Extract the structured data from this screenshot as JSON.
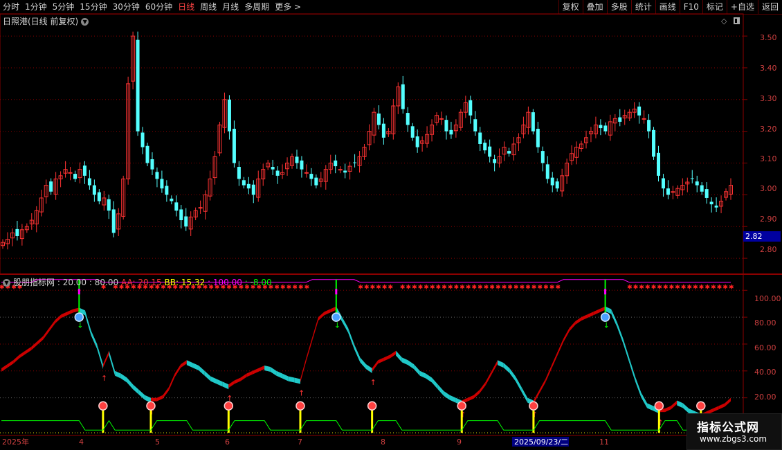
{
  "toolbar": {
    "timeframes": [
      "分时",
      "1分钟",
      "5分钟",
      "15分钟",
      "30分钟",
      "60分钟",
      "日线",
      "周线",
      "月线",
      "多周期",
      "更多 >"
    ],
    "active_index": 6,
    "right_buttons": [
      "复权",
      "叠加",
      "多股",
      "统计",
      "画线",
      "F10",
      "标记",
      "+自选",
      "返回"
    ]
  },
  "main_title": "日照港(日线 前复权)",
  "price_axis": {
    "ticks": [
      "3.50",
      "3.40",
      "3.30",
      "3.20",
      "3.10",
      "3.00",
      "2.90",
      "2.80"
    ],
    "current_price": "2.82"
  },
  "indicator": {
    "name": "股朋指标网",
    "p1": ": 20.00",
    "p2": ": 80.00",
    "aa": "AA: 20.15",
    "bb": "BB: 15.32",
    "c": ": 100.00",
    "d": ": -8.00",
    "axis_ticks": [
      "100.00",
      "80.00",
      "60.00",
      "40.00",
      "20.00"
    ]
  },
  "date_axis": {
    "labels": [
      "2025年",
      "4",
      "5",
      "6",
      "7",
      "8",
      "9",
      "2025/09/23/二",
      "11"
    ]
  },
  "watermark": {
    "line1": "指标公式网",
    "line2": "www.zbgs3.com"
  },
  "colors": {
    "up": "#ff3333",
    "down": "#54ffff",
    "grid": "#8b0000",
    "magenta": "#ff00ff",
    "yellow": "#ffff00",
    "green": "#00ff00"
  },
  "chart_data": {
    "type": "candlestick",
    "price_ylim": [
      2.75,
      3.57
    ],
    "closes": [
      2.85,
      2.86,
      2.88,
      2.87,
      2.89,
      2.9,
      2.92,
      2.95,
      2.99,
      3.03,
      3.01,
      3.05,
      3.06,
      3.08,
      3.07,
      3.05,
      3.08,
      3.06,
      3.03,
      3.0,
      2.98,
      2.99,
      2.95,
      2.88,
      2.94,
      3.05,
      3.35,
      3.5,
      3.2,
      3.15,
      3.1,
      3.08,
      3.05,
      3.02,
      3.0,
      2.98,
      2.95,
      2.92,
      2.9,
      2.93,
      2.95,
      2.96,
      3.0,
      3.05,
      3.12,
      3.22,
      3.3,
      3.2,
      3.1,
      3.05,
      3.03,
      3.02,
      3.0,
      3.05,
      3.08,
      3.1,
      3.08,
      3.06,
      3.07,
      3.1,
      3.12,
      3.1,
      3.08,
      3.07,
      3.05,
      3.03,
      3.05,
      3.08,
      3.1,
      3.09,
      3.08,
      3.07,
      3.09,
      3.1,
      3.12,
      3.15,
      3.2,
      3.26,
      3.22,
      3.18,
      3.2,
      3.28,
      3.34,
      3.27,
      3.22,
      3.18,
      3.15,
      3.17,
      3.19,
      3.22,
      3.25,
      3.24,
      3.2,
      3.19,
      3.22,
      3.26,
      3.29,
      3.25,
      3.2,
      3.16,
      3.14,
      3.12,
      3.1,
      3.12,
      3.15,
      3.13,
      3.16,
      3.18,
      3.22,
      3.26,
      3.2,
      3.15,
      3.1,
      3.05,
      3.03,
      3.02,
      3.06,
      3.1,
      3.13,
      3.15,
      3.16,
      3.18,
      3.2,
      3.22,
      3.21,
      3.2,
      3.23,
      3.24,
      3.23,
      3.25,
      3.26,
      3.27,
      3.25,
      3.24,
      3.2,
      3.12,
      3.06,
      3.02,
      3.0,
      3.01,
      3.02,
      3.03,
      3.04,
      3.05,
      3.03,
      3.01,
      2.99,
      2.97,
      2.96,
      2.98,
      3.01,
      3.03
    ],
    "indicator_ylim": [
      -8,
      112
    ],
    "aa": [
      42,
      45,
      48,
      52,
      55,
      58,
      62,
      66,
      72,
      78,
      82,
      84,
      86,
      87,
      85,
      70,
      60,
      45,
      55,
      40,
      38,
      35,
      30,
      26,
      22,
      20,
      20,
      22,
      28,
      38,
      45,
      48,
      46,
      44,
      40,
      36,
      34,
      32,
      30,
      33,
      35,
      38,
      40,
      42,
      44,
      43,
      40,
      38,
      36,
      35,
      34,
      50,
      65,
      80,
      84,
      86,
      88,
      80,
      72,
      60,
      50,
      45,
      42,
      48,
      50,
      52,
      55,
      50,
      48,
      45,
      40,
      38,
      35,
      30,
      25,
      22,
      20,
      18,
      20,
      22,
      26,
      32,
      40,
      48,
      46,
      42,
      36,
      28,
      20,
      18,
      26,
      34,
      44,
      54,
      64,
      72,
      77,
      80,
      82,
      84,
      86,
      88,
      86,
      76,
      64,
      50,
      36,
      24,
      16,
      14,
      12,
      12,
      14,
      18,
      16,
      12,
      10,
      8,
      10,
      12,
      14,
      16,
      20
    ]
  }
}
